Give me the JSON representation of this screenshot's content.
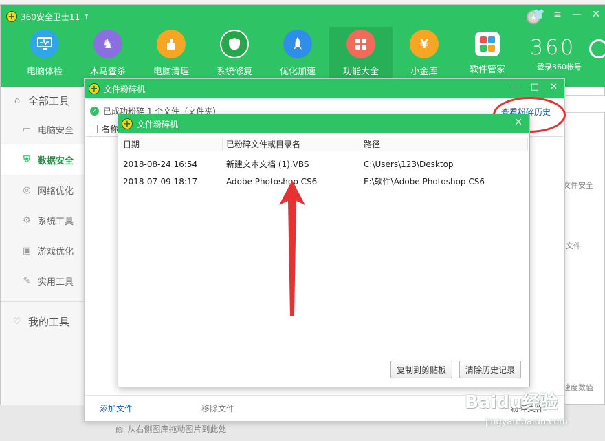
{
  "app": {
    "title": "360安全卫士11",
    "brand": "360",
    "login": "登录360帐号"
  },
  "nav": [
    {
      "label": "电脑体检",
      "icon": "monitor-icon",
      "color": "#2fa6e8"
    },
    {
      "label": "木马查杀",
      "icon": "horse-icon",
      "color": "#8b6fe0"
    },
    {
      "label": "电脑清理",
      "icon": "broom-icon",
      "color": "#f6a623"
    },
    {
      "label": "系统修复",
      "icon": "shield-icon",
      "color": "#27a64c"
    },
    {
      "label": "优化加速",
      "icon": "rocket-icon",
      "color": "#2f8ee8"
    },
    {
      "label": "功能大全",
      "icon": "grid-icon",
      "color": "#ef6b5a"
    },
    {
      "label": "小金库",
      "icon": "money-bag-icon",
      "color": "#f6a623"
    },
    {
      "label": "软件管家",
      "icon": "apps-icon",
      "color": "#ffffff"
    }
  ],
  "sidebar": {
    "all_tools": "全部工具",
    "items": [
      {
        "label": "电脑安全",
        "icon": "monitor-icon"
      },
      {
        "label": "数据安全",
        "icon": "shield-icon"
      },
      {
        "label": "网络优化",
        "icon": "globe-icon"
      },
      {
        "label": "系统工具",
        "icon": "gear-icon"
      },
      {
        "label": "游戏优化",
        "icon": "gamepad-icon"
      },
      {
        "label": "实用工具",
        "icon": "wrench-icon"
      }
    ],
    "my_tools": "我的工具"
  },
  "right_hints": {
    "hint1": "文件安全",
    "hint2": "文件",
    "hint3": "速度数值",
    "drag": "从右侧图库拖动图片到此处"
  },
  "outer_dialog": {
    "title": "文件粉碎机",
    "status": "已成功粉碎 1 个文件（文件夹）",
    "history_link": "查看粉碎历史",
    "column_name": "名称",
    "add_file": "添加文件",
    "remove_file": "移除文件",
    "shred_file": "粉碎文件"
  },
  "inner_dialog": {
    "title": "文件粉碎机",
    "columns": [
      "日期",
      "已粉碎文件或目录名",
      "路径"
    ],
    "rows": [
      [
        "2018-08-24 16:54",
        "新建文本文档 (1).VBS",
        "C:\\Users\\123\\Desktop"
      ],
      [
        "2018-07-09 18:17",
        "Adobe Photoshop CS6",
        "E:\\软件\\Adobe Photoshop CS6"
      ]
    ],
    "copy_button": "复制到剪贴板",
    "clear_button": "清除历史记录"
  },
  "watermark": {
    "main": "Baidu经验",
    "sub": "jingyan.baidu.com"
  },
  "colors": {
    "accent": "#2ec365",
    "annotation": "#e63232",
    "link": "#1e5aa8"
  }
}
